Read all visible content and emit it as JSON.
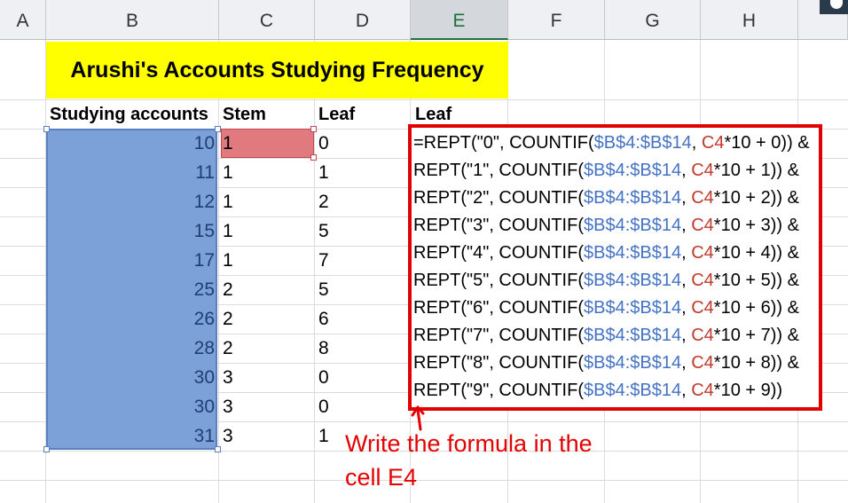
{
  "columns": [
    "A",
    "B",
    "C",
    "D",
    "E",
    "F",
    "G",
    "H"
  ],
  "active_column": "E",
  "title": "Arushi's Accounts Studying Frequency",
  "headers": {
    "b": "Studying accounts",
    "c": "Stem",
    "d": "Leaf",
    "e": "Leaf"
  },
  "rows": [
    {
      "b": "10",
      "c": "1",
      "d": "0"
    },
    {
      "b": "11",
      "c": "1",
      "d": "1"
    },
    {
      "b": "12",
      "c": "1",
      "d": "2"
    },
    {
      "b": "15",
      "c": "1",
      "d": "5"
    },
    {
      "b": "17",
      "c": "1",
      "d": "7"
    },
    {
      "b": "25",
      "c": "2",
      "d": "5"
    },
    {
      "b": "26",
      "c": "2",
      "d": "6"
    },
    {
      "b": "28",
      "c": "2",
      "d": "8"
    },
    {
      "b": "30",
      "c": "3",
      "d": "0"
    },
    {
      "b": "30",
      "c": "3",
      "d": "0"
    },
    {
      "b": "31",
      "c": "3",
      "d": "1"
    }
  ],
  "formula": {
    "first_prefix": "=REPT(\"0\", COUNTIF(",
    "range": "$B$4:$B$14",
    "sep": ", ",
    "ref": "C4",
    "lines": [
      {
        "prefix": "=REPT(\"0\", COUNTIF(",
        "tail": "*10 + 0",
        "suffix": ")) &"
      },
      {
        "prefix": "REPT(\"1\", COUNTIF(",
        "tail": "*10 + 1",
        "suffix": ")) &"
      },
      {
        "prefix": "REPT(\"2\", COUNTIF(",
        "tail": "*10 + 2",
        "suffix": ")) &"
      },
      {
        "prefix": "REPT(\"3\", COUNTIF(",
        "tail": "*10 + 3",
        "suffix": ")) &"
      },
      {
        "prefix": "REPT(\"4\", COUNTIF(",
        "tail": "*10 + 4",
        "suffix": ")) &"
      },
      {
        "prefix": "REPT(\"5\", COUNTIF(",
        "tail": "*10 + 5",
        "suffix": ")) &"
      },
      {
        "prefix": "REPT(\"6\", COUNTIF(",
        "tail": "*10 + 6",
        "suffix": ")) &"
      },
      {
        "prefix": "REPT(\"7\", COUNTIF(",
        "tail": "*10 + 7",
        "suffix": ")) &"
      },
      {
        "prefix": "REPT(\"8\", COUNTIF(",
        "tail": "*10 + 8",
        "suffix": ")) &"
      },
      {
        "prefix": "REPT(\"9\", COUNTIF(",
        "tail": "*10 + 9",
        "suffix": "))"
      }
    ]
  },
  "annotation": {
    "line1": "Write the formula in the",
    "line2": "cell E4"
  },
  "colors": {
    "selection": "#7ca0d8",
    "highlight_cell": "#e07a7f",
    "title_bg": "#ffff00",
    "annotation": "#e30000"
  }
}
